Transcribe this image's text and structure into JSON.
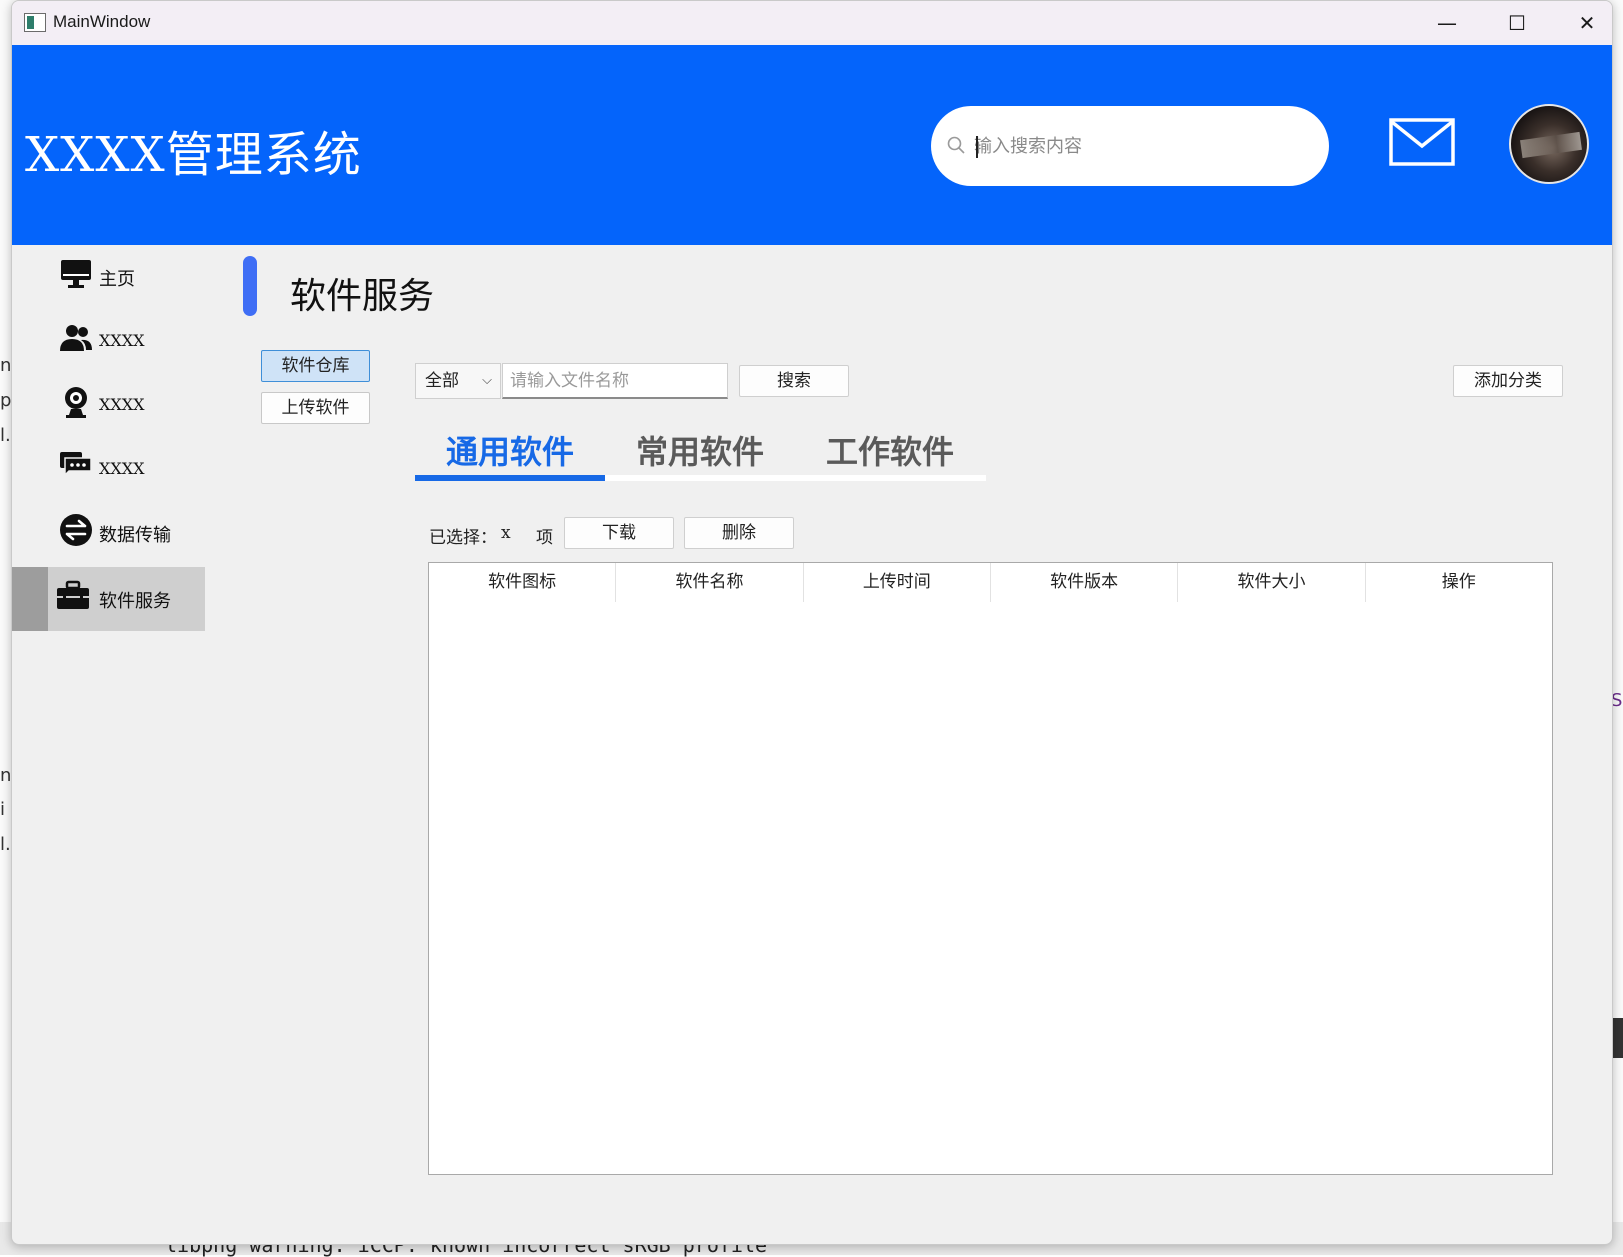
{
  "window": {
    "title": "MainWindow"
  },
  "window_controls": {
    "minimize": "—",
    "maximize": "☐",
    "close": "✕"
  },
  "header": {
    "system_title": "XXXX管理系统",
    "search_placeholder": "输入搜索内容",
    "brand_color": "#0464fb"
  },
  "sidebar": {
    "items": [
      {
        "label": "主页",
        "icon": "monitor-icon"
      },
      {
        "label": "XXXX",
        "icon": "users-icon"
      },
      {
        "label": "XXXX",
        "icon": "webcam-icon"
      },
      {
        "label": "XXXX",
        "icon": "chat-icon"
      },
      {
        "label": "数据传输",
        "icon": "transfer-icon"
      },
      {
        "label": "软件服务",
        "icon": "toolbox-icon",
        "active": true
      }
    ]
  },
  "main": {
    "page_title": "软件服务",
    "subnav": {
      "repo": "软件仓库",
      "upload": "上传软件"
    },
    "filter": {
      "category_selected": "全部",
      "file_name_placeholder": "请输入文件名称",
      "search_label": "搜索",
      "add_category_label": "添加分类"
    },
    "tabs": [
      {
        "label": "通用软件",
        "active": true
      },
      {
        "label": "常用软件"
      },
      {
        "label": "工作软件"
      }
    ],
    "selection": {
      "label": "已选择：",
      "count": "x",
      "unit": "项",
      "download_label": "下载",
      "delete_label": "删除"
    },
    "table": {
      "columns": [
        "软件图标",
        "软件名称",
        "上传时间",
        "软件版本",
        "软件大小",
        "操作"
      ],
      "rows": []
    }
  },
  "background": {
    "terminal_text": "libpng warning: iCCP: known incorrect sRGB profile",
    "fragments": [
      "ne",
      "p",
      "l.c",
      "ne",
      "i",
      "l.u",
      "S"
    ]
  },
  "colors": {
    "accent": "#1769e6",
    "marker": "#3f6ef5",
    "active_item_bg": "#cfcfcf"
  }
}
